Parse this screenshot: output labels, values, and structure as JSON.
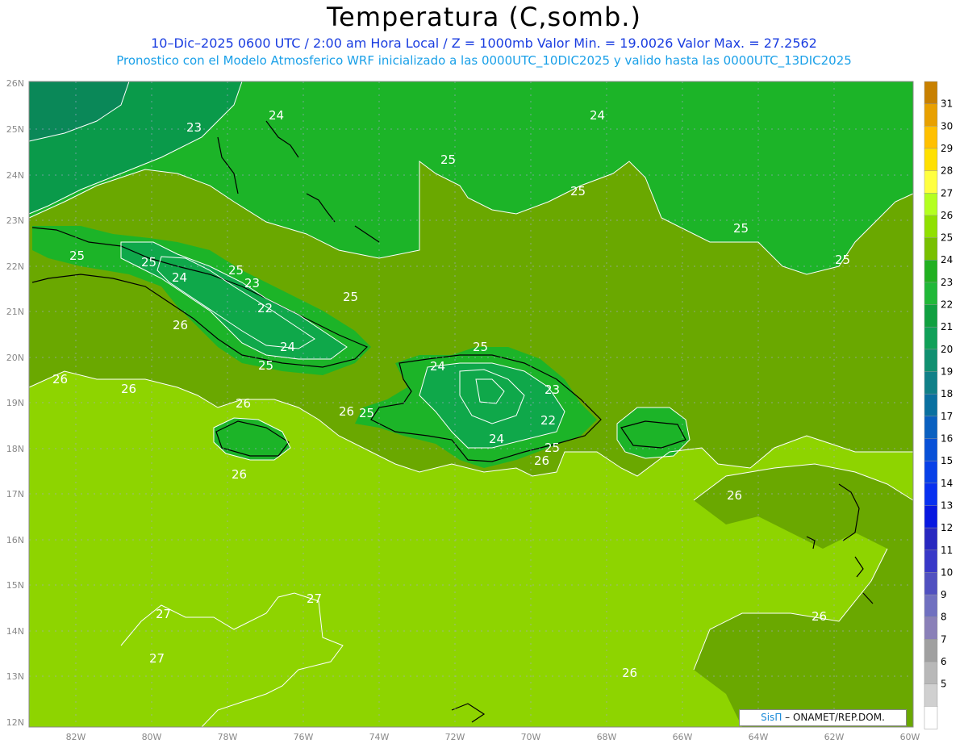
{
  "header": {
    "title": "Temperatura (C,somb.)",
    "subtitle_line1": "10–Dic–2025  0600 UTC / 2:00 am Hora Local / Z = 1000mb   Valor Min. = 19.0026  Valor Max. = 27.2562",
    "subtitle_line2": "Pronostico con el Modelo Atmosferico WRF inicializado a las 0000UTC_10DIC2025 y valido hasta las  0000UTC_13DIC2025"
  },
  "map": {
    "lat_labels": [
      "26N",
      "25N",
      "24N",
      "23N",
      "22N",
      "21N",
      "20N",
      "19N",
      "18N",
      "17N",
      "16N",
      "15N",
      "14N",
      "13N",
      "12N"
    ],
    "lon_labels": [
      "82W",
      "80W",
      "78W",
      "76W",
      "74W",
      "72W",
      "70W",
      "68W",
      "66W",
      "64W",
      "62W",
      "60W"
    ],
    "contour_labels": [
      "23",
      "24",
      "24",
      "25",
      "25",
      "25",
      "25",
      "25",
      "25",
      "25",
      "25",
      "24",
      "23",
      "22",
      "24",
      "25",
      "26",
      "26",
      "26",
      "26",
      "26",
      "25",
      "24",
      "23",
      "22",
      "24",
      "25",
      "26",
      "25",
      "26",
      "26",
      "26",
      "27",
      "27",
      "27",
      "26",
      "25"
    ],
    "colors": {
      "level_22": "#0a9a4a",
      "level_23": "#12a83a",
      "level_24": "#1cb428",
      "level_25": "#6aa800",
      "level_26": "#8ed400",
      "level_27": "#b4e800",
      "contour": "#ffffff",
      "coast": "#000000"
    }
  },
  "colorbar": {
    "labels": [
      "31",
      "30",
      "29",
      "28",
      "27",
      "26",
      "25",
      "24",
      "23",
      "22",
      "21",
      "20",
      "19",
      "18",
      "17",
      "16",
      "15",
      "14",
      "13",
      "12",
      "11",
      "10",
      "9",
      "8",
      "7",
      "6",
      "5"
    ],
    "colors": [
      "#c88000",
      "#e8a000",
      "#ffc000",
      "#ffe000",
      "#ffff40",
      "#b4ff20",
      "#90e000",
      "#78c000",
      "#20b020",
      "#20b838",
      "#10a040",
      "#10a058",
      "#109070",
      "#108088",
      "#0a70a0",
      "#0a60c0",
      "#0850d8",
      "#0840e8",
      "#0830f0",
      "#0818e0",
      "#2828c0",
      "#3838c8",
      "#5050c0",
      "#7070c0",
      "#8a80b8",
      "#a0a0a0",
      "#b8b8b8",
      "#d0d0d0",
      "#ffffff"
    ]
  },
  "credit": {
    "sis": "SisΠ",
    "rest": "– ONAMET/REP.DOM."
  }
}
